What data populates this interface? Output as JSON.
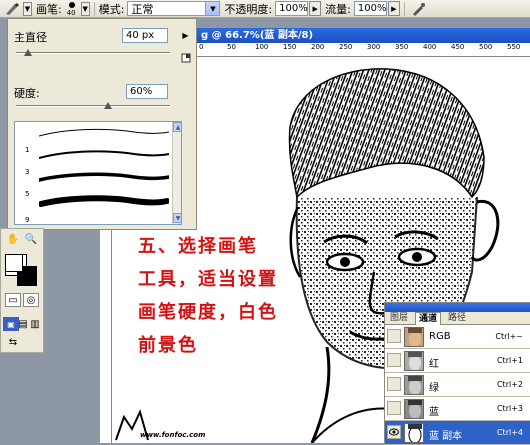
{
  "options_bar": {
    "brush_label": "画笔:",
    "brush_size_preview": "40",
    "mode_label": "模式:",
    "mode_value": "正常",
    "opacity_label": "不透明度:",
    "opacity_value": "100%",
    "flow_label": "流量:",
    "flow_value": "100%"
  },
  "brush_panel": {
    "diameter_label": "主直径",
    "diameter_value": "40 px",
    "diameter_fraction": 0.08,
    "hardness_label": "硬度:",
    "hardness_value": "60%",
    "hardness_fraction": 0.6,
    "presets": [
      {
        "number": "1"
      },
      {
        "number": "3"
      },
      {
        "number": "5"
      },
      {
        "number": "9"
      }
    ]
  },
  "document": {
    "title": "g @ 66.7%(蓝 副本/8)",
    "ruler_ticks": [
      "0",
      "50",
      "100",
      "150",
      "200",
      "250",
      "300",
      "350",
      "400",
      "450",
      "500",
      "550"
    ],
    "caption_lines": [
      "五、选择画笔",
      "工具，适当设置",
      "画笔硬度，白色",
      "前景色"
    ],
    "watermark": "www.fonfoc.com"
  },
  "channels_panel": {
    "tabs": [
      "图层",
      "通道",
      "路径"
    ],
    "active_tab": "通道",
    "rows": [
      {
        "name": "RGB",
        "shortcut": "Ctrl+~",
        "selected": false
      },
      {
        "name": "红",
        "shortcut": "Ctrl+1",
        "selected": false
      },
      {
        "name": "绿",
        "shortcut": "Ctrl+2",
        "selected": false
      },
      {
        "name": "蓝",
        "shortcut": "Ctrl+3",
        "selected": false
      },
      {
        "name": "蓝 副本",
        "shortcut": "Ctrl+4",
        "selected": true
      }
    ]
  },
  "colors": {
    "caption_red": "#d41212",
    "title_blue": "#2f6be0",
    "selected_row": "#2f62c9"
  }
}
